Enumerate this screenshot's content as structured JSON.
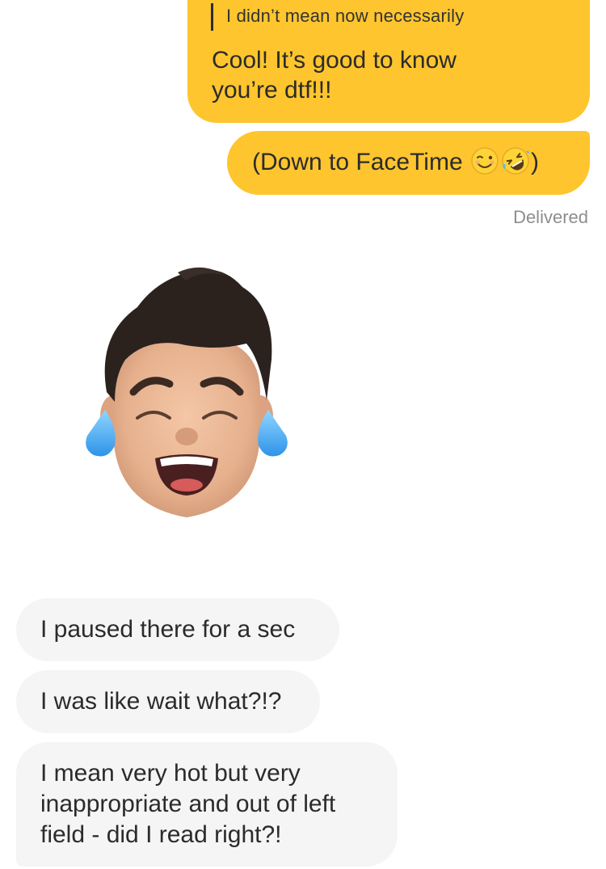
{
  "messages": {
    "sent": [
      {
        "quote": "I didn’t mean now necessarily",
        "text": "Cool! It’s good to know\nyou’re dtf!!!"
      },
      {
        "text_before_emoji": "(Down to FaceTime ",
        "emojis": [
          "winking-face",
          "rolling-on-floor-laughing"
        ],
        "text_after_emoji": ")"
      }
    ],
    "status": "Delivered",
    "memoji_sticker": "memoji-tears-of-joy",
    "received": [
      {
        "text": "I paused there for a sec"
      },
      {
        "text": "I was like wait what?!?"
      },
      {
        "text": "I mean very hot but very\ninappropriate and out of left\nfield - did I read right?!"
      }
    ]
  },
  "colors": {
    "sent_bubble": "#fec52e",
    "received_bubble": "#f5f5f5",
    "text": "#2b2b2b",
    "status_text": "#8e8e8e"
  }
}
